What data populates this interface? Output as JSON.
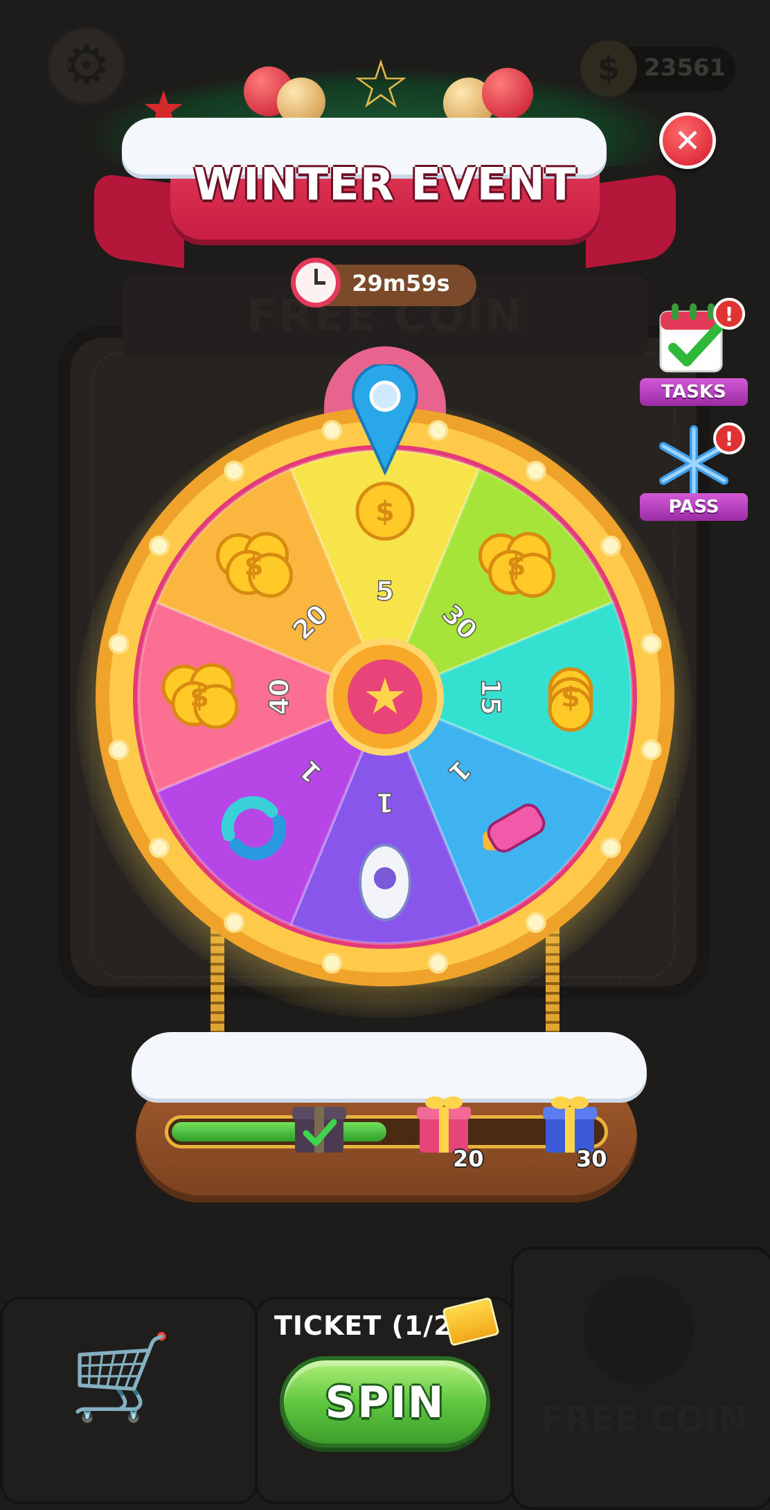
{
  "background": {
    "coin_balance": "23561",
    "panel_title": "FREE COIN",
    "tab_free_coin_label": "FREE COIN"
  },
  "event": {
    "title": "WINTER EVENT",
    "timer": "29m59s",
    "close_icon": "close-icon"
  },
  "side_buttons": [
    {
      "label": "TASKS",
      "icon": "calendar-check-icon",
      "alert": "!"
    },
    {
      "label": "PASS",
      "icon": "snowflake-icon",
      "alert": "!"
    }
  ],
  "wheel": {
    "center_icon": "star-icon",
    "segments": [
      {
        "label": "5",
        "reward": "coin-icon",
        "color": "#f7e34a"
      },
      {
        "label": "30",
        "reward": "coin-pile-icon",
        "color": "#a6e43a"
      },
      {
        "label": "15",
        "reward": "coin-stack-icon",
        "color": "#34e0cf"
      },
      {
        "label": "1",
        "reward": "hammer-icon",
        "color": "#3fb2f0"
      },
      {
        "label": "1",
        "reward": "rocket-icon",
        "color": "#8856ea"
      },
      {
        "label": "1",
        "reward": "shuffle-icon",
        "color": "#b646e6"
      },
      {
        "label": "40",
        "reward": "coin-pile-icon",
        "color": "#fb6f93"
      },
      {
        "label": "20",
        "reward": "coin-pile-icon",
        "color": "#fbb640"
      }
    ]
  },
  "progress": {
    "fraction": 0.5,
    "milestones": [
      {
        "icon": "gift-claimed-icon",
        "label": "",
        "claimed": true
      },
      {
        "icon": "gift-pink-icon",
        "label": "20",
        "claimed": false
      },
      {
        "icon": "gift-blue-icon",
        "label": "30",
        "claimed": false
      }
    ]
  },
  "spin": {
    "ticket_label": "TICKET (1/2)",
    "button_label": "SPIN"
  },
  "colors": {
    "spin_green": "#5fc840",
    "banner_red": "#d42648",
    "gold": "#f5b731"
  }
}
